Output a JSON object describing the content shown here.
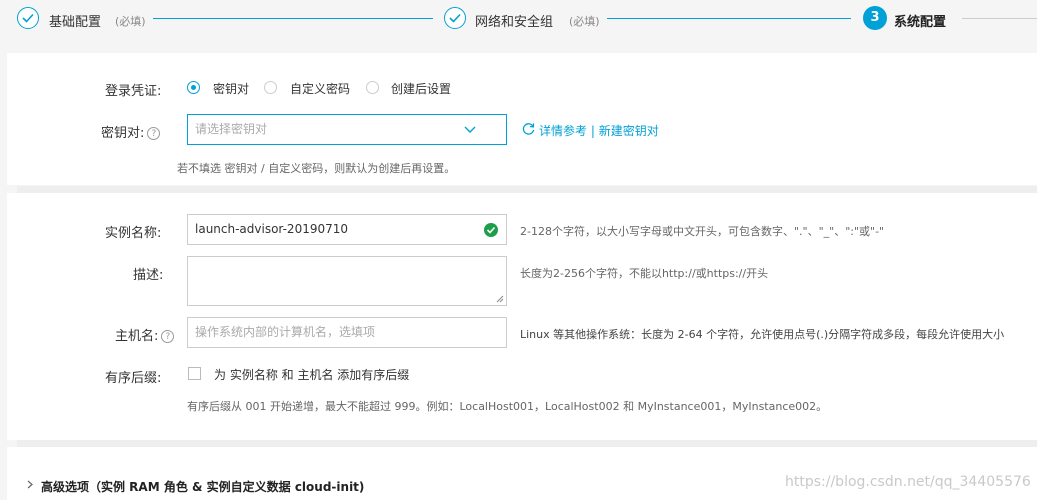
{
  "steps": [
    {
      "label": "基础配置",
      "sub": "(必填)",
      "state": "done"
    },
    {
      "label": "网络和安全组",
      "sub": "(必填)",
      "state": "done"
    },
    {
      "label": "系统配置",
      "number": "3",
      "state": "active"
    }
  ],
  "credential": {
    "label": "登录凭证:",
    "options": [
      "密钥对",
      "自定义密码",
      "创建后设置"
    ],
    "selected": "密钥对"
  },
  "keypair": {
    "label": "密钥对:",
    "help": "?",
    "placeholder": "请选择密钥对",
    "links": {
      "detail": "详情参考",
      "sep": "|",
      "new": "新建密钥对"
    },
    "hint": "若不填选 密钥对 / 自定义密码，则默认为创建后再设置。"
  },
  "instance": {
    "label": "实例名称:",
    "value": "launch-advisor-20190710",
    "hint": "2-128个字符，以大小写字母或中文开头，可包含数字、\".\"、\"_\"、\":\"或\"-\""
  },
  "description": {
    "label": "描述:",
    "value": "",
    "hint": "长度为2-256个字符，不能以http://或https://开头"
  },
  "hostname": {
    "label": "主机名:",
    "help": "?",
    "placeholder": "操作系统内部的计算机名，选填项",
    "hint": "Linux 等其他操作系统：长度为 2-64 个字符，允许使用点号(.)分隔字符成多段，每段允许使用大小"
  },
  "suffix": {
    "label": "有序后缀:",
    "option": "为 实例名称 和 主机名 添加有序后缀",
    "hint": "有序后缀从 001 开始递增，最大不能超过 999。例如：LocalHost001，LocalHost002 和 MyInstance001，MyInstance002。"
  },
  "advanced": {
    "label": "高级选项（实例 RAM 角色 & 实例自定义数据 cloud-init)"
  },
  "watermark": "https://blog.csdn.net/qq_34405576",
  "colors": {
    "accent": "#00a1d6",
    "success": "#1e9e4a"
  }
}
